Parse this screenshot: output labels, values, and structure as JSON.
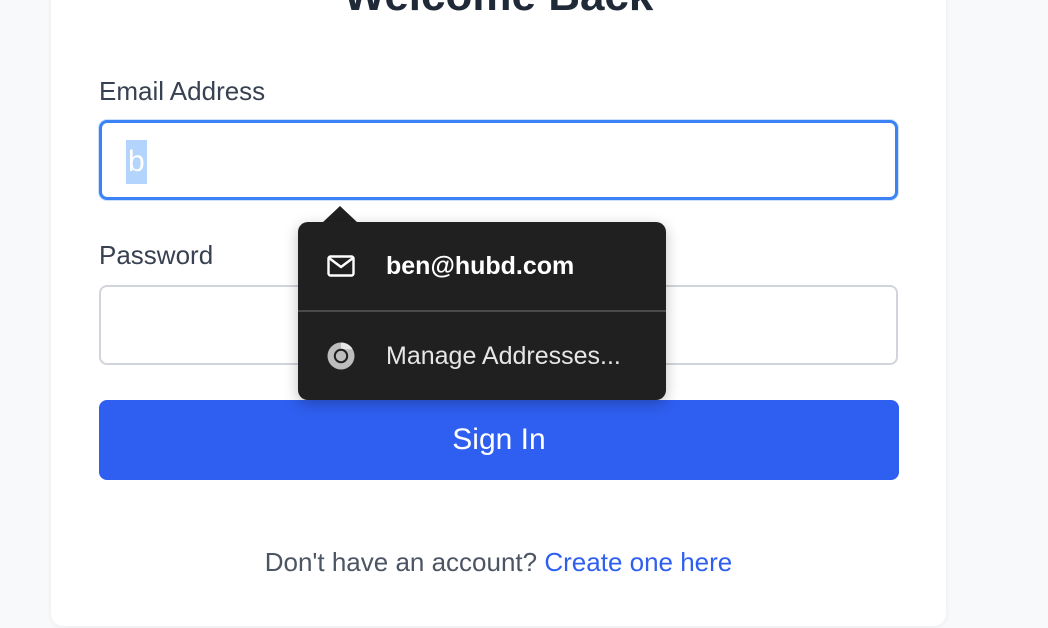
{
  "page": {
    "title": "Welcome Back"
  },
  "form": {
    "email_label": "Email Address",
    "email_value": "b",
    "password_label": "Password",
    "password_value": "",
    "signin_label": "Sign In"
  },
  "footer": {
    "prompt": "Don't have an account?",
    "link_label": "Create one here"
  },
  "autofill": {
    "suggestion": {
      "icon": "mail-icon",
      "label": "ben@hubd.com"
    },
    "manage": {
      "icon": "chrome-icon",
      "label": "Manage Addresses..."
    }
  },
  "colors": {
    "accent": "#2f5ff1",
    "focus_ring": "#3b82f6",
    "popup_bg": "#202020",
    "text": "#374151"
  }
}
